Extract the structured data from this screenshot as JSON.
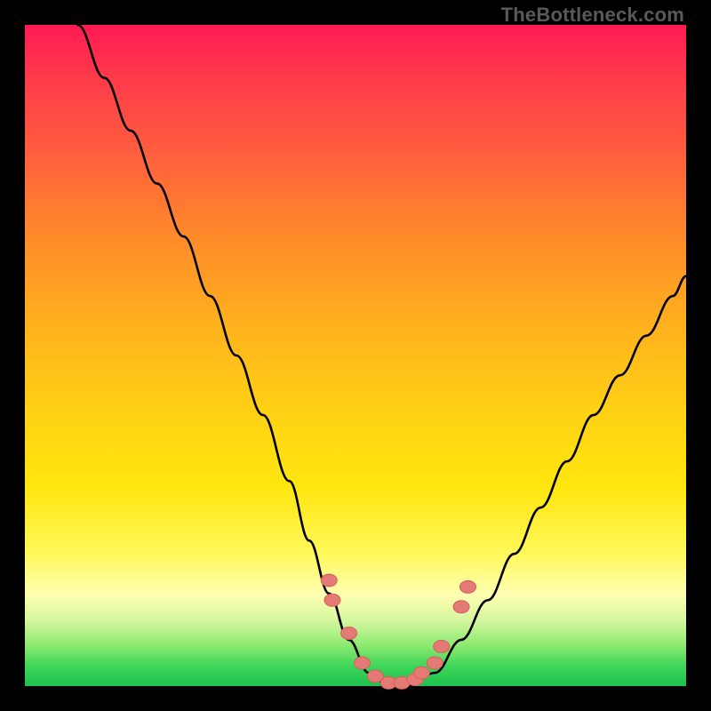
{
  "attribution": "TheBottleneck.com",
  "chart_data": {
    "type": "line",
    "title": "",
    "xlabel": "",
    "ylabel": "",
    "xlim": [
      0,
      100
    ],
    "ylim": [
      0,
      100
    ],
    "grid": false,
    "series": [
      {
        "name": "bottleneck-curve",
        "x": [
          8,
          12,
          16,
          20,
          24,
          28,
          32,
          36,
          40,
          43,
          46,
          49,
          52,
          55,
          58,
          62,
          66,
          70,
          74,
          78,
          82,
          86,
          90,
          94,
          98,
          100
        ],
        "values": [
          100,
          92,
          84,
          76,
          68,
          59,
          50,
          41,
          31,
          22,
          14,
          7,
          2,
          0,
          0,
          2,
          7,
          13,
          20,
          27,
          34,
          41,
          47,
          53,
          59,
          62
        ]
      }
    ],
    "markers": {
      "name": "highlight-points",
      "x": [
        46,
        46.5,
        49,
        51,
        53,
        55,
        57,
        59,
        60,
        62,
        63,
        66,
        67
      ],
      "values": [
        16,
        13,
        8,
        3.5,
        1.5,
        0.5,
        0.5,
        1,
        2,
        3.5,
        6,
        12,
        15
      ]
    },
    "gradient_meaning": "top=red (high bottleneck), bottom=green (low bottleneck)"
  },
  "colors": {
    "frame": "#000000",
    "curve": "#000000",
    "marker_fill": "#e47a75"
  }
}
